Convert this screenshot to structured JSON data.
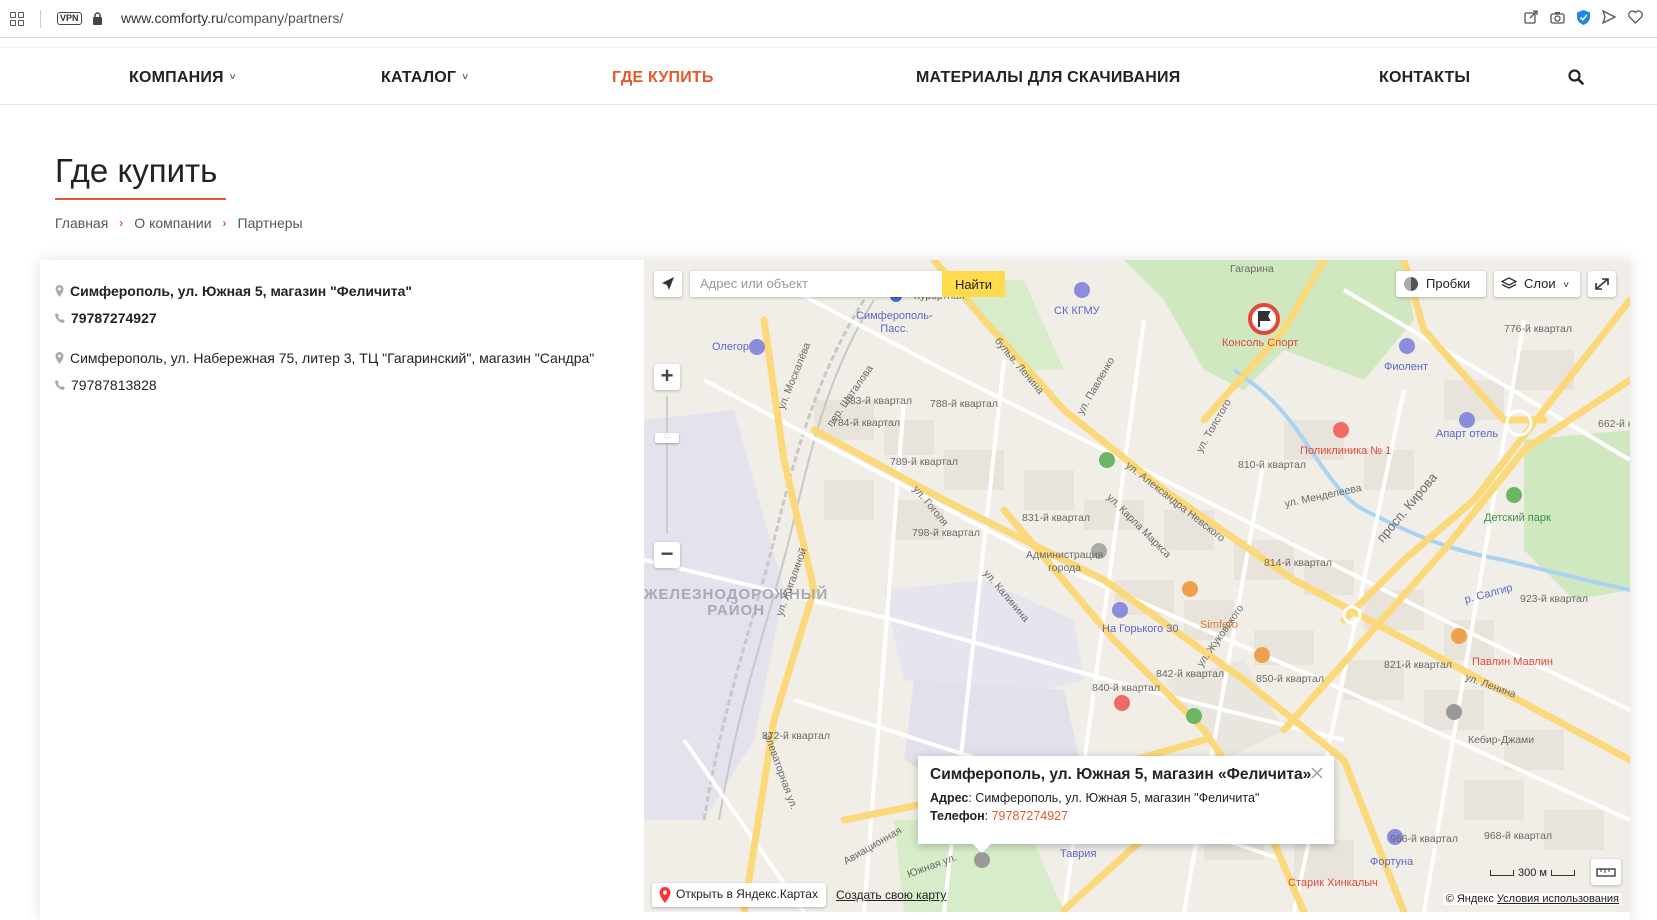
{
  "browser": {
    "vpn_label": "VPN",
    "url_domain": "www.comforty.ru",
    "url_path": "/company/partners/"
  },
  "nav": {
    "items": [
      {
        "label": "КОМПАНИЯ",
        "has_dropdown": true,
        "active": false
      },
      {
        "label": "КАТАЛОГ",
        "has_dropdown": true,
        "active": false
      },
      {
        "label": "ГДЕ КУПИТЬ",
        "has_dropdown": false,
        "active": true
      },
      {
        "label": "МАТЕРИАЛЫ ДЛЯ СКАЧИВАНИЯ",
        "has_dropdown": false,
        "active": false
      },
      {
        "label": "КОНТАКТЫ",
        "has_dropdown": false,
        "active": false
      }
    ],
    "search_icon": "search-icon",
    "accent_color": "#e2592b"
  },
  "page": {
    "title": "Где купить",
    "breadcrumb": [
      "Главная",
      "О компании",
      "Партнеры"
    ]
  },
  "partners": [
    {
      "address": "Симферополь, ул. Южная 5, магазин \"Феличита\"",
      "phone": "79787274927",
      "selected": true
    },
    {
      "address": "Симферополь, ул. Набережная 75, литер 3, ТЦ \"Гагаринский\", магазин \"Сандра\"",
      "phone": "79787813828",
      "selected": false
    }
  ],
  "map": {
    "search_placeholder": "Адрес или объект",
    "find_label": "Найти",
    "traffic_label": "Пробки",
    "layers_label": "Слои",
    "zoom_in": "+",
    "zoom_out": "−",
    "balloon": {
      "title": "Симферополь, ул. Южная 5, магазин «Феличита»",
      "address_label": "Адрес",
      "address_value": "Симферополь, ул. Южная 5, магазин \"Феличита\"",
      "phone_label": "Телефон",
      "phone_value": "79787274927"
    },
    "open_yandex_label": "Открыть в Яндекс.Картах",
    "create_map_label": "Создать свою карту",
    "copyright_prefix": "© Яндекс",
    "terms_label": "Условия использования",
    "scale_label": "300 м",
    "labels": {
      "gagarina": "Гагарина",
      "kurortnaya": "Курортная",
      "sk_kgmu": "СК КГМУ",
      "konsol_sport": "Консоль Спорт",
      "simferopol_pass": "Симферополь-\nПасс.",
      "oleg": "Олегор",
      "fiolent": "Фиолент",
      "apart_hotel": "Апарт отель",
      "poliklinika": "Поликлиника № 1",
      "detsky_park": "Детский парк",
      "administration": "Администрация\nгорода",
      "na_gorkogo": "На Горького 30",
      "simfero": "Simfero",
      "pavlin_mavlin": "Павлин Мавлин",
      "kebir_dzhami": "Кебир-Джами",
      "fortuna": "Фортуна",
      "tavriya": "Таврия",
      "starik_khinkalych": "Старик Хинкалыч",
      "district": "ЖЕЛЕЗНОДОРОЖНЫЙ\nРАЙОН",
      "ul_moskaleva": "ул. Москалёва",
      "ul_shatalova": "пер. Шаталова",
      "bulv_lenina": "бульв. Ленина",
      "ul_pavlenko": "ул. Павленко",
      "ul_tolstogo": "ул. Толстого",
      "ul_al_nevskogo": "ул. Александра Невского",
      "ul_k_marksa": "ул. Карла Маркса",
      "ul_gogolya": "ул. Гоголя",
      "ul_kalinina": "ул. Калинина",
      "ul_zhukovskogo": "ул. Жуковского",
      "pr_kirova": "просп. Кирова",
      "ul_mendeleeva": "ул. Менделеева",
      "ul_zhilyaloy": "ул. Жигалиной",
      "ul_lenina": "ул. Ленина",
      "r_salgir": "р. Салгир",
      "ul_yuzhnaya": "Южная ул.",
      "aviatsionnaya": "Авиационная",
      "elevatornaya": "Элеваторная ул.",
      "kv_783": "783-й квартал",
      "kv_784": "784-й квартал",
      "kv_788": "788-й квартал",
      "kv_789": "789-й квартал",
      "kv_798": "798-й квартал",
      "kv_810": "810-й квартал",
      "kv_814": "814-й квартал",
      "kv_831": "831-й квартал",
      "kv_842": "842-й квартал",
      "kv_850": "850-й квартал",
      "kv_840": "840-й квартал",
      "kv_821": "821-й квартал",
      "kv_923": "923-й квартал",
      "kv_872": "872-й квартал",
      "kv_776": "776-й квартал",
      "kv_662": "662-й к",
      "kv_966": "966-й квартал",
      "kv_968": "968-й квартал"
    }
  }
}
